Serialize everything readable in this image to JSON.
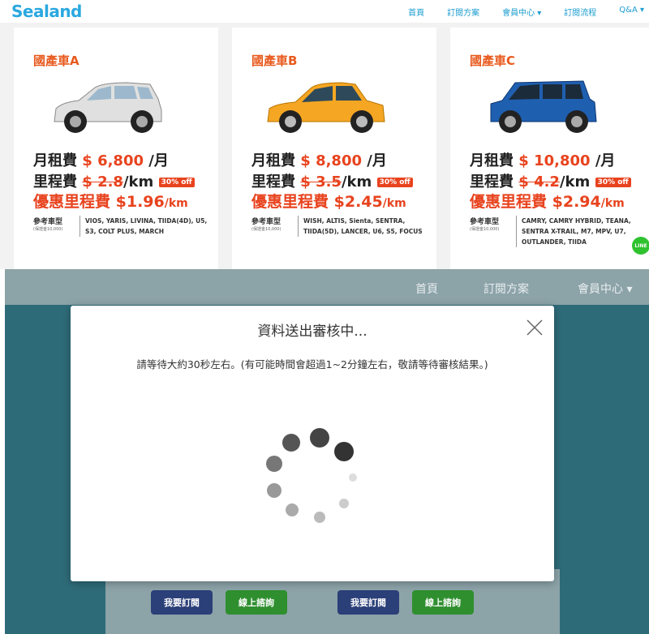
{
  "top": {
    "logo": "Sealand",
    "nav": [
      "首頁",
      "訂閱方案",
      "會員中心 ▾",
      "訂閱流程",
      "Q&A ▾"
    ],
    "cards": [
      {
        "title": "國產車A",
        "rent_label": "月租費",
        "rent_value": "$ 6,800",
        "rent_unit": "/月",
        "mileage_label": "里程費",
        "mileage_old": "$ 2.8",
        "mileage_unit": "/km",
        "discount": "30% off",
        "promo_label": "優惠里程費",
        "promo_value": "$1.96",
        "promo_unit": "/km",
        "models_label": "參考車型",
        "models_note": "(保證金10,000)",
        "models_list": "VIOS, YARIS, LIVINA, TIIDA(4D), U5, S3, COLT PLUS, MARCH",
        "car_color": "#d9d9d9"
      },
      {
        "title": "國產車B",
        "rent_label": "月租費",
        "rent_value": "$ 8,800",
        "rent_unit": "/月",
        "mileage_label": "里程費",
        "mileage_old": "$ 3.5",
        "mileage_unit": "/km",
        "discount": "30% off",
        "promo_label": "優惠里程費",
        "promo_value": "$2.45",
        "promo_unit": "/km",
        "models_label": "參考車型",
        "models_note": "(保證金10,000)",
        "models_list": "WISH, ALTIS, Sienta, SENTRA, TIIDA(5D), LANCER, U6, S5, FOCUS",
        "car_color": "#f5a623"
      },
      {
        "title": "國產車C",
        "rent_label": "月租費",
        "rent_value": "$ 10,800",
        "rent_unit": "/月",
        "mileage_label": "里程費",
        "mileage_old": "$ 4.2",
        "mileage_unit": "/km",
        "discount": "30% off",
        "promo_label": "優惠里程費",
        "promo_value": "$2.94",
        "promo_unit": "/km",
        "models_label": "參考車型",
        "models_note": "(保證金10,000)",
        "models_list": "CAMRY, CAMRY HYBRID, TEANA, SENTRA X-TRAIL, M7, MPV, U7, OUTLANDER, TIIDA",
        "car_color": "#1f5fb0"
      }
    ],
    "line_badge": "LINE"
  },
  "bottom": {
    "nav": [
      "首頁",
      "訂閱方案",
      "會員中心 ▾"
    ],
    "modal_title": "資料送出審核中...",
    "modal_message": "請等待大約30秒左右。(有可能時間會超過1~2分鐘左右，敬請等待審核結果。)",
    "buttons": [
      {
        "subscribe": "我要訂閱",
        "chat": "線上諮詢"
      },
      {
        "subscribe": "我要訂閱",
        "chat": "線上諮詢"
      }
    ]
  }
}
